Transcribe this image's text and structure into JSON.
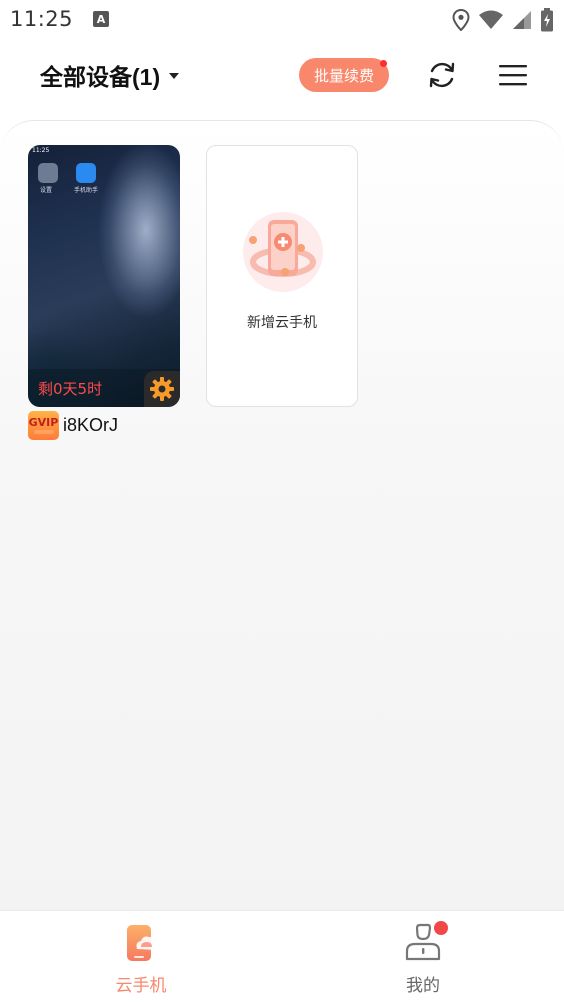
{
  "status_bar": {
    "time": "11:25",
    "indicator": "A",
    "icons": [
      "location-icon",
      "wifi-icon",
      "signal-icon",
      "battery-charging-icon"
    ]
  },
  "header": {
    "title": "全部设备(1)",
    "renew_label": "批量续费",
    "refresh_icon": "refresh-icon",
    "menu_icon": "menu-icon"
  },
  "devices": [
    {
      "preview_time": "11:25",
      "app1_label": "设置",
      "app2_label": "手机助手",
      "remaining": "剩0天5时",
      "settings_icon": "gear-icon",
      "badge": "GVIP",
      "name": "i8KOrJ"
    }
  ],
  "add_card": {
    "label": "新增云手机",
    "icon": "add-phone-icon"
  },
  "bottom_nav": {
    "items": [
      {
        "label": "云手机",
        "icon": "cloud-phone-icon",
        "active": true
      },
      {
        "label": "我的",
        "icon": "profile-icon",
        "active": false
      }
    ]
  },
  "colors": {
    "accent": "#f8876b",
    "remaining_text": "#ff4a4a",
    "notification_dot": "#f04848"
  }
}
